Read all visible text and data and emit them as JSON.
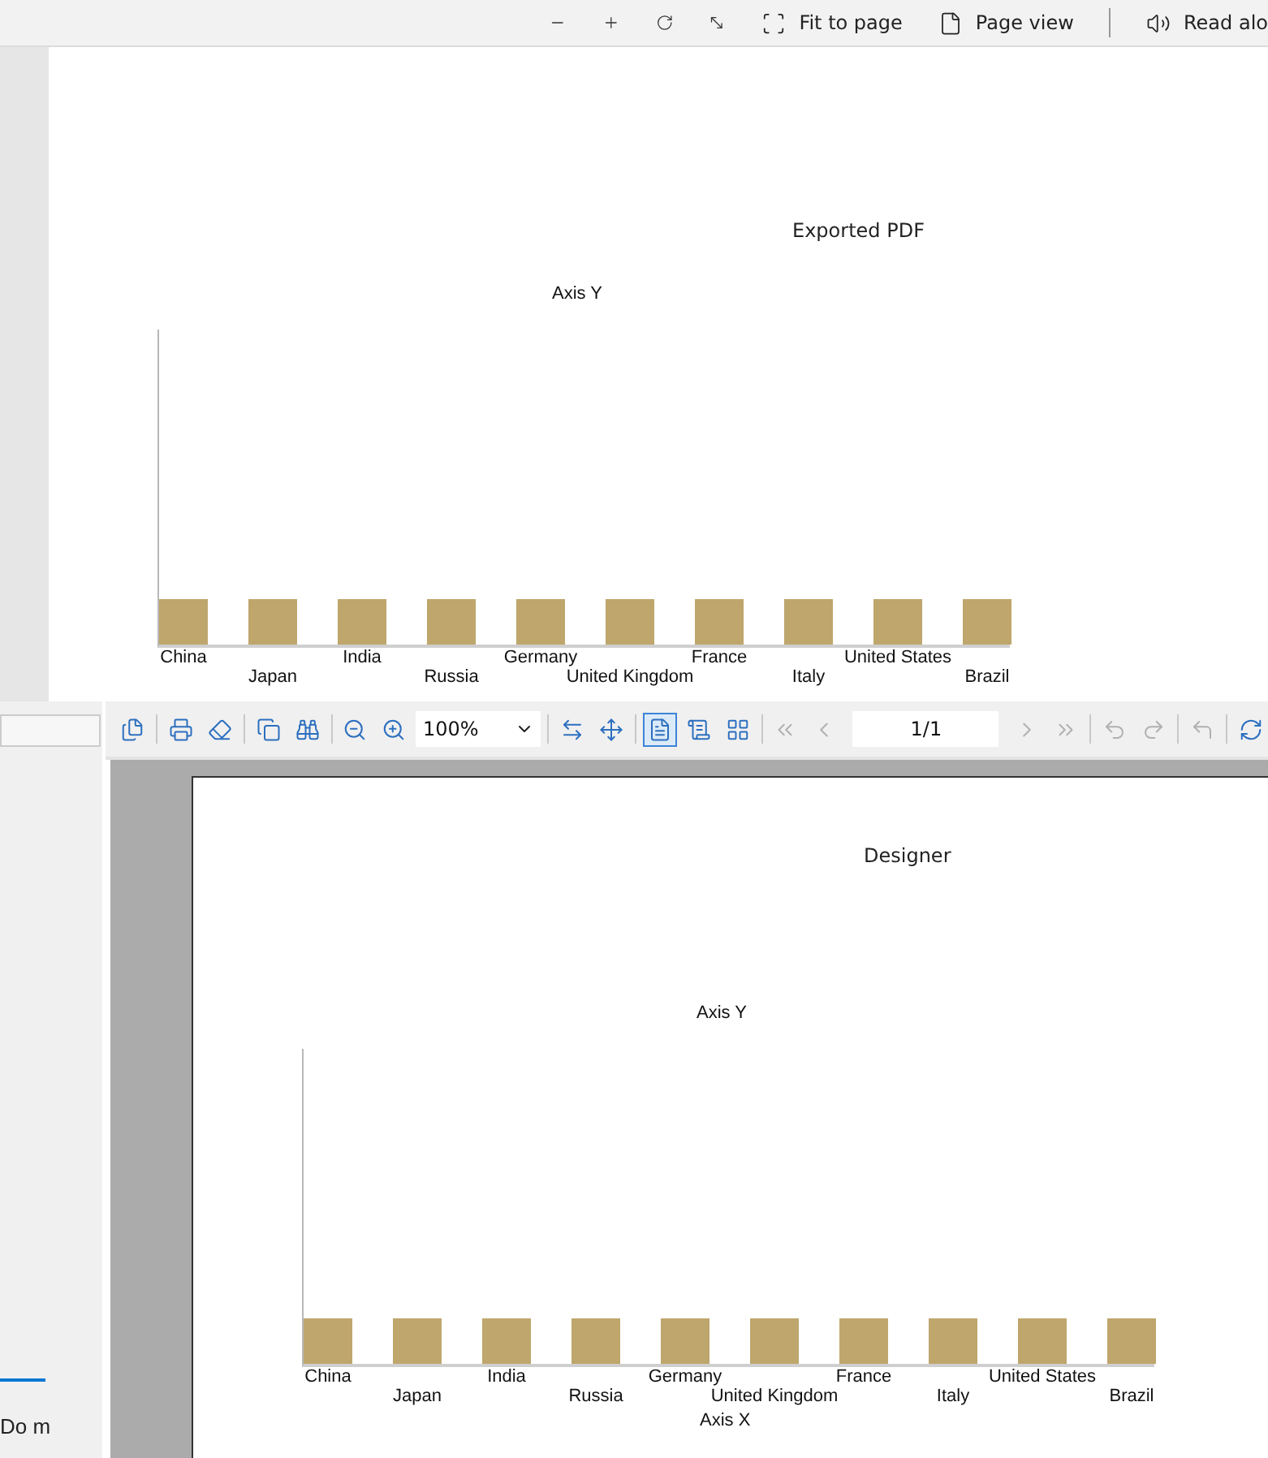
{
  "pdf_viewer": {
    "toolbar": {
      "fit_button": "Fit to page",
      "page_view_button": "Page view",
      "read_aloud_button": "Read alo"
    },
    "page": {
      "title": "Exported PDF",
      "y_axis_label": "Axis Y",
      "categories": [
        "China",
        "Japan",
        "India",
        "Russia",
        "Germany",
        "United Kingdom",
        "France",
        "Italy",
        "United States",
        "Brazil"
      ]
    }
  },
  "designer": {
    "side_panel": {
      "text": "Do m"
    },
    "toolbar": {
      "zoom": "100%",
      "page": "1/1",
      "view_buttons": [
        {
          "kind": "single",
          "selected": true
        },
        {
          "kind": "continuous",
          "selected": false
        },
        {
          "kind": "grid",
          "selected": false
        }
      ],
      "nav_buttons": [
        {
          "kind": "first",
          "disabled": true
        },
        {
          "kind": "prev",
          "disabled": true
        }
      ],
      "nav_buttons_after": [
        {
          "kind": "next",
          "disabled": true
        },
        {
          "kind": "last",
          "disabled": true
        }
      ],
      "history_buttons": [
        {
          "kind": "undo",
          "disabled": true
        },
        {
          "kind": "redo",
          "disabled": true
        }
      ]
    },
    "page": {
      "title": "Designer",
      "y_axis_label": "Axis Y",
      "x_axis_label": "Axis X",
      "categories": [
        "China",
        "Japan",
        "India",
        "Russia",
        "Germany",
        "United Kingdom",
        "France",
        "Italy",
        "United States",
        "Brazil"
      ]
    }
  }
}
